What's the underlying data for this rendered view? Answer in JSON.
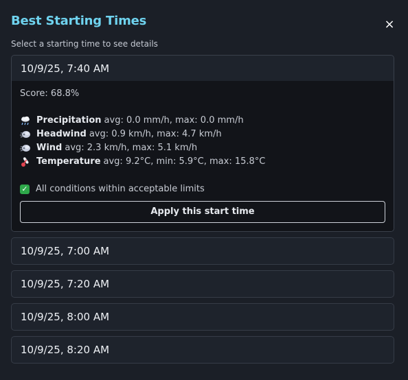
{
  "header": {
    "title": "Best Starting Times",
    "subtitle": "Select a starting time to see details",
    "close_label": "×"
  },
  "options": [
    {
      "label": "10/9/25, 7:40 AM",
      "expanded": true,
      "score": "Score: 68.8%",
      "metrics": [
        {
          "icon": "rain-cloud-icon",
          "name": "Precipitation",
          "text": "avg: 0.0 mm/h, max: 0.0 mm/h"
        },
        {
          "icon": "wind-face-icon",
          "name": "Headwind",
          "text": "avg: 0.9 km/h, max: 4.7 km/h"
        },
        {
          "icon": "wind-face-icon",
          "name": "Wind",
          "text": "avg: 2.3 km/h, max: 5.1 km/h"
        },
        {
          "icon": "thermometer-icon",
          "name": "Temperature",
          "text": "avg: 9.2°C, min: 5.9°C, max: 15.8°C"
        }
      ],
      "status": "All conditions within acceptable limits",
      "apply_label": "Apply this start time"
    },
    {
      "label": "10/9/25, 7:00 AM",
      "expanded": false
    },
    {
      "label": "10/9/25, 7:20 AM",
      "expanded": false
    },
    {
      "label": "10/9/25, 8:00 AM",
      "expanded": false
    },
    {
      "label": "10/9/25, 8:20 AM",
      "expanded": false
    }
  ],
  "colors": {
    "accent": "#6fd3ef",
    "background": "#1b1f27",
    "check": "#2ea84a"
  }
}
